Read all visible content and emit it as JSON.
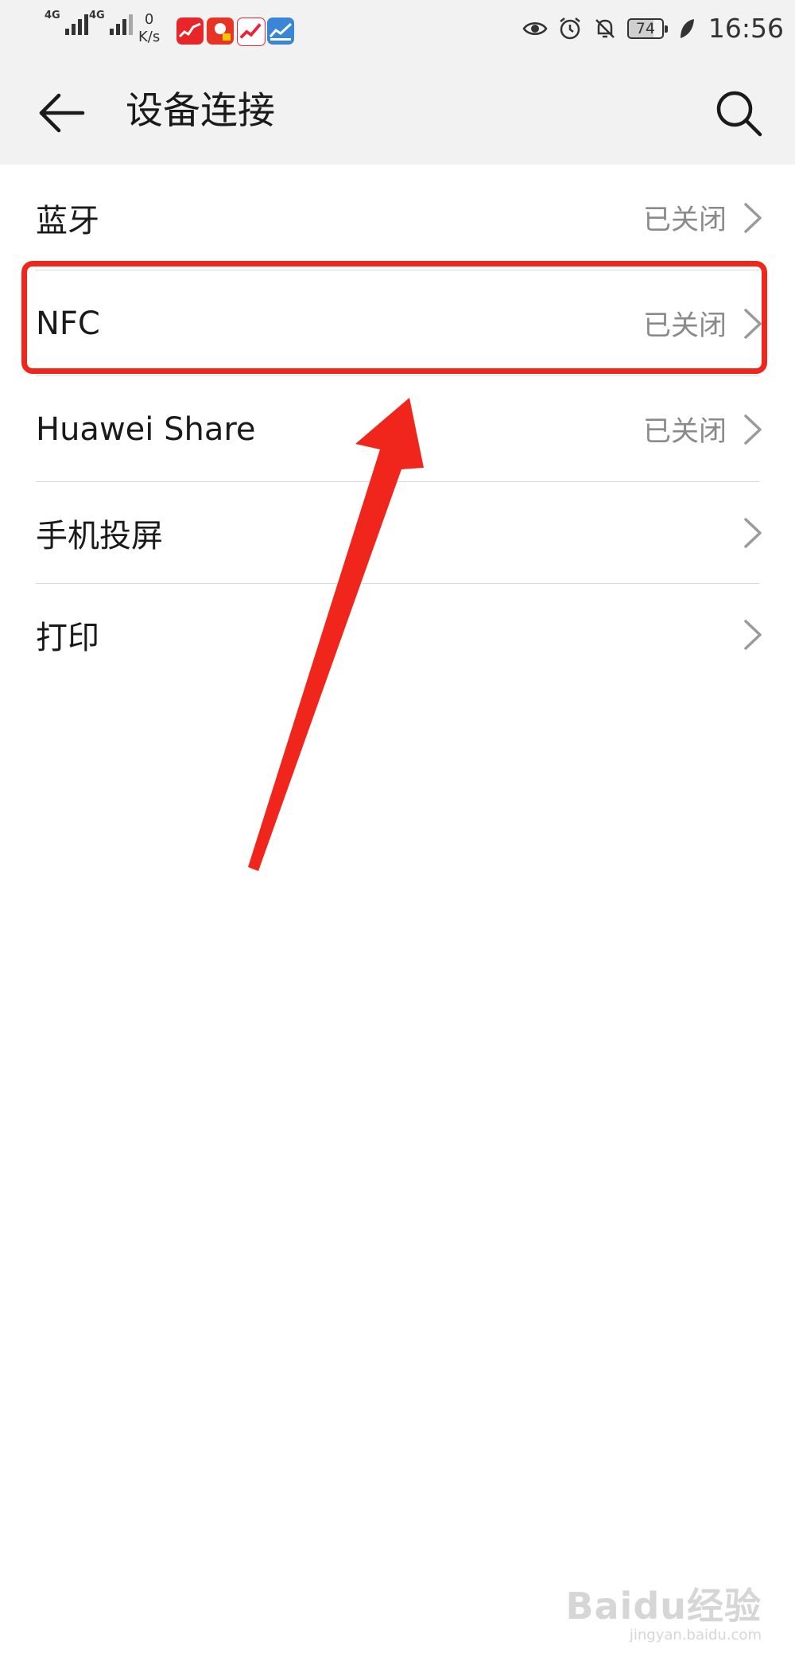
{
  "status_bar": {
    "network_1": "4G",
    "network_2": "4G",
    "speed_value": "0",
    "speed_unit": "K/s",
    "battery": "74",
    "time": "16:56",
    "app_icons": [
      "app-icon-stock-red",
      "app-icon-news-red",
      "app-icon-trend-red",
      "app-icon-chart-blue"
    ],
    "right_icons": [
      "eye-icon",
      "alarm-icon",
      "bell-off-icon",
      "battery-icon",
      "leaf-icon"
    ]
  },
  "header": {
    "title": "设备连接",
    "back_icon": "arrow-left-icon",
    "search_icon": "search-icon"
  },
  "items": [
    {
      "label": "蓝牙",
      "value": "已关闭"
    },
    {
      "label": "NFC",
      "value": "已关闭"
    },
    {
      "label": "Huawei Share",
      "value": "已关闭"
    },
    {
      "label": "手机投屏",
      "value": ""
    },
    {
      "label": "打印",
      "value": ""
    }
  ],
  "annotation": {
    "highlight_color": "#f0261c",
    "highlighted_item": "NFC"
  },
  "watermark": {
    "main": "Baidu经验",
    "sub": "jingyan.baidu.com"
  },
  "colors": {
    "header_bg": "#f2f2f2",
    "value_text": "#8a8a8a",
    "divider": "#dcdcdc"
  }
}
